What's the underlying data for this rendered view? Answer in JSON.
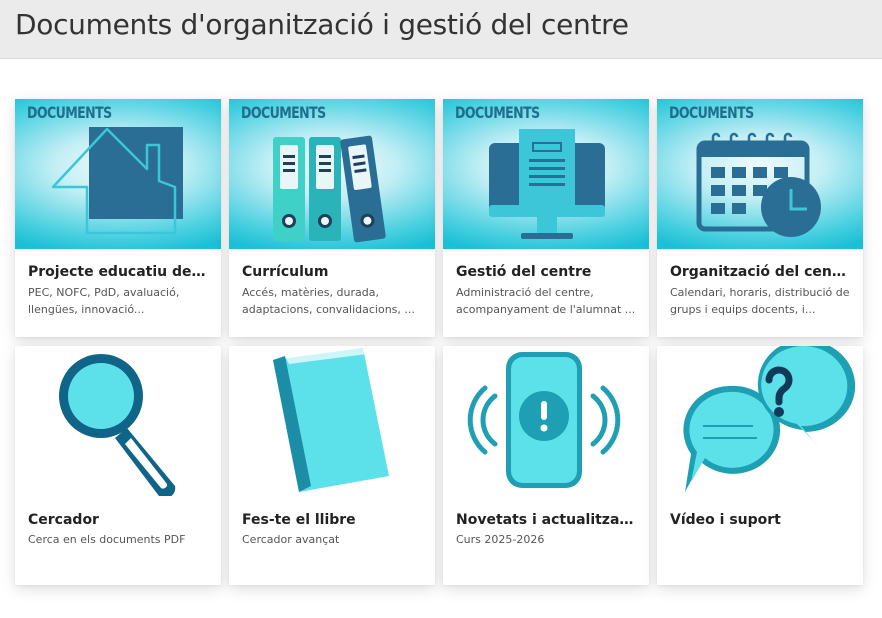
{
  "header": {
    "title": "Documents d'organització i gestió del centre"
  },
  "colors": {
    "banner_light": "#c2eef5",
    "banner_dark": "#1bbfd6",
    "icon_navy": "#2a6e96",
    "icon_teal": "#3dc9d6",
    "icon_cyan": "#5ce1ea"
  },
  "cards": [
    {
      "tag": "DOCUMENTS",
      "title": "Projecte educatiu de centre",
      "description": "PEC, NOFC, PdD, avaluació, llengües, innovació...",
      "icon": "house-icon"
    },
    {
      "tag": "DOCUMENTS",
      "title": "Currículum",
      "description": "Accés, matèries, durada, adaptacions, convalidacions, ...",
      "icon": "binders-icon"
    },
    {
      "tag": "DOCUMENTS",
      "title": "Gestió del centre",
      "description": "Administració del centre, acompanyament de l'alumnat ...",
      "icon": "monitor-icon"
    },
    {
      "tag": "DOCUMENTS",
      "title": "Organització del centre",
      "description": "Calendari, horaris, distribució de grups i equips docents, i...",
      "icon": "calendar-clock-icon"
    },
    {
      "title": "Cercador",
      "description": "Cerca en els documents PDF",
      "icon": "magnifier-icon"
    },
    {
      "title": "Fes-te el llibre",
      "description": "Cercador avançat",
      "icon": "book-icon"
    },
    {
      "title": "Novetats i actualitzacions",
      "description": "Curs 2025-2026",
      "icon": "phone-alert-icon"
    },
    {
      "title": "Vídeo i suport",
      "description": "",
      "icon": "chat-question-icon"
    }
  ]
}
